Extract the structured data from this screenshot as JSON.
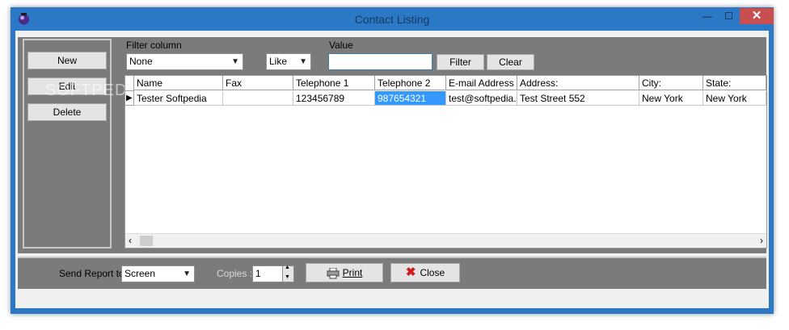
{
  "window": {
    "title": "Contact Listing",
    "minimize_icon": "minimize-icon",
    "maximize_icon": "maximize-icon",
    "close_icon": "close-icon"
  },
  "sidebar": {
    "new_label": "New",
    "edit_label": "Edit",
    "delete_label": "Delete",
    "watermark": "SOFTPEDIA"
  },
  "filter": {
    "column_label": "Filter column",
    "column_value": "None",
    "operator_value": "Like",
    "value_label": "Value",
    "value_text": "",
    "filter_label": "Filter",
    "clear_label": "Clear"
  },
  "grid": {
    "columns": [
      "Name",
      "Fax",
      "Telephone 1",
      "Telephone 2",
      "E-mail Address",
      "Address:",
      "City:",
      "State:"
    ],
    "rows": [
      [
        "Tester Softpedia",
        "",
        "123456789",
        "987654321",
        "test@softpedia.com",
        "Test Street 552",
        "New York",
        "New York"
      ]
    ]
  },
  "report": {
    "send_label": "Send Report to:",
    "send_value": "Screen",
    "copies_label": "Copies :",
    "copies_value": "1",
    "print_label": "Print",
    "close_label": "Close"
  },
  "colors": {
    "title_bar": "#2b78c6",
    "panel": "#7b7b7b",
    "selection": "#3399ff",
    "close_accent": "#c74f4f"
  }
}
